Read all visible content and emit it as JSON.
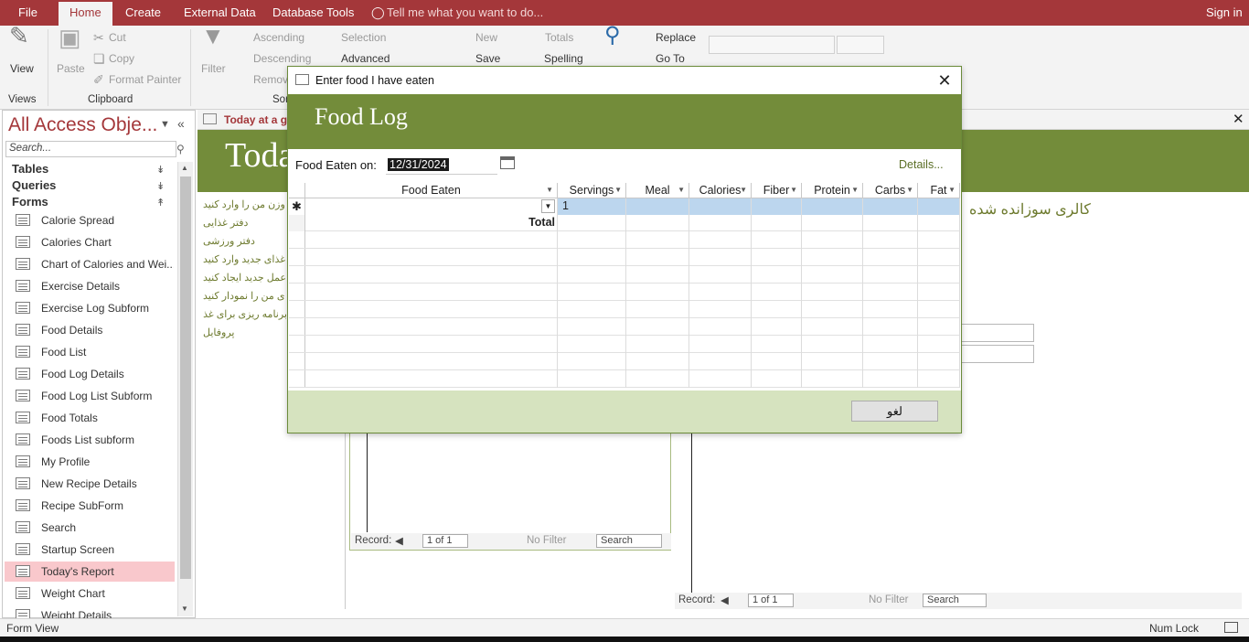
{
  "ribbon_tabs": [
    "File",
    "Home",
    "Create",
    "External Data",
    "Database Tools"
  ],
  "tell_me": "Tell me what you want to do...",
  "sign_in": "Sign in",
  "ribbon": {
    "view": "View",
    "paste": "Paste",
    "cut": "Cut",
    "copy": "Copy",
    "format_painter": "Format Painter",
    "filter": "Filter",
    "ascending": "Ascending",
    "descending": "Descending",
    "remove": "Remov",
    "selection": "Selection",
    "advanced": "Advanced",
    "new": "New",
    "save": "Save",
    "totals": "Totals",
    "spelling": "Spelling",
    "replace": "Replace",
    "go_to": "Go To",
    "groups": {
      "views": "Views",
      "clipboard": "Clipboard",
      "sort": "Sor"
    }
  },
  "nav": {
    "title": "All Access Obje...",
    "search_placeholder": "Search...",
    "sections": [
      "Tables",
      "Queries",
      "Forms"
    ],
    "items": [
      "Calorie Spread",
      "Calories Chart",
      "Chart of Calories and Wei...",
      "Exercise Details",
      "Exercise Log Subform",
      "Food Details",
      "Food List",
      "Food Log Details",
      "Food Log List Subform",
      "Food Totals",
      "Foods List subform",
      "My Profile",
      "New Recipe Details",
      "Recipe SubForm",
      "Search",
      "Startup Screen",
      "Today's Report",
      "Weight Chart",
      "Weight Details"
    ],
    "selected": "Today's Report"
  },
  "doc": {
    "tab_title": "Today at a gla",
    "big_title": "Toda",
    "right_text": "کالری سوزانده شده",
    "links": [
      "وزن من را وارد کنید",
      "دفتر غذایی",
      "دفتر ورزشی",
      "غذای جدید وارد کنید",
      "عمل جدید ایجاد کنید",
      "ی من را نمودار کنید",
      "برنامه ریزی برای غذا",
      "پروفایل"
    ],
    "record_label": "Record:",
    "record_value": "1 of 1",
    "no_filter": "No Filter",
    "search": "Search"
  },
  "dialog": {
    "title": "Enter food I have eaten",
    "heading": "Food Log",
    "date_label": "Food Eaten on:",
    "date_value": "12/31/2024",
    "details_link": "Details...",
    "columns": [
      "Food Eaten",
      "Servings",
      "Meal",
      "Calories",
      "Fiber",
      "Protein",
      "Carbs",
      "Fat"
    ],
    "new_row_servings": "1",
    "total_label": "Total",
    "cancel": "لغو"
  },
  "status": {
    "left": "Form View",
    "right": "Num Lock"
  },
  "colors": {
    "brand": "#a4373a",
    "green": "#738c3a",
    "footer_green": "#d6e3bf",
    "selected_nav": "#f9c8cc"
  }
}
